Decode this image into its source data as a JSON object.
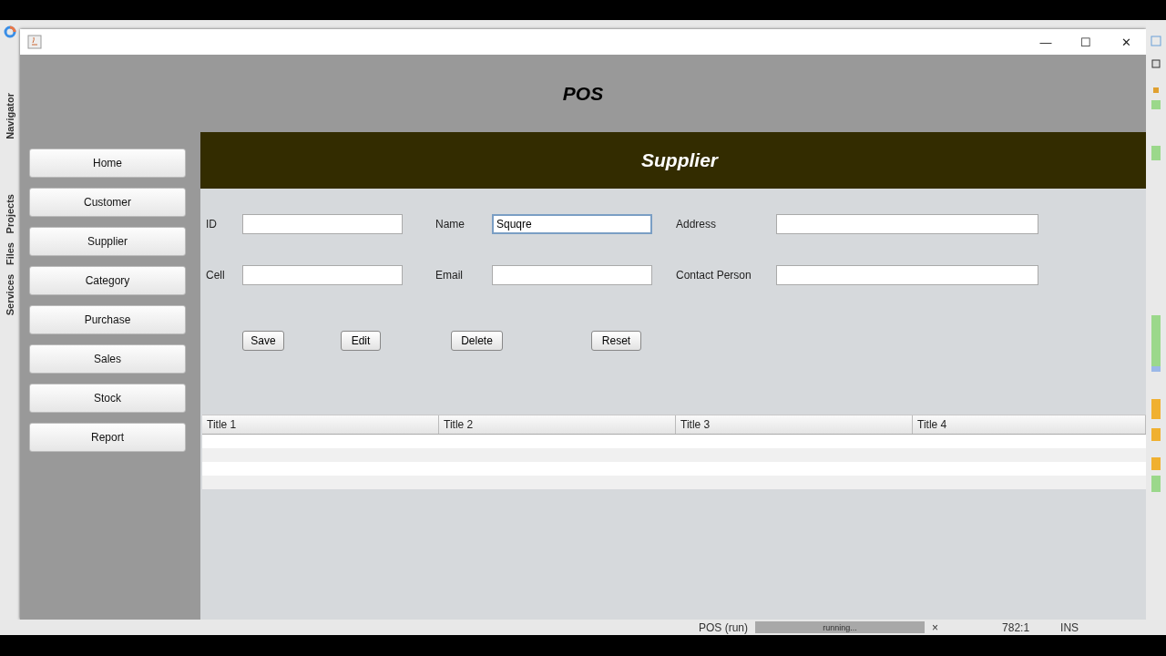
{
  "ide_side_tabs": [
    "Navigator",
    "Projects",
    "Files",
    "Services"
  ],
  "window": {
    "title_buttons": [
      "—",
      "☐",
      "✕"
    ]
  },
  "app_title": "POS",
  "sidebar": {
    "items": [
      {
        "label": "Home"
      },
      {
        "label": "Customer"
      },
      {
        "label": "Supplier"
      },
      {
        "label": "Category"
      },
      {
        "label": "Purchase"
      },
      {
        "label": "Sales"
      },
      {
        "label": "Stock"
      },
      {
        "label": "Report"
      }
    ]
  },
  "panel_title": "Supplier",
  "form": {
    "fields": [
      {
        "label": "ID",
        "focused": false
      },
      {
        "label": "Name",
        "value": "Squqre",
        "focused": true
      },
      {
        "label": "Address",
        "focused": false
      },
      {
        "label": "Cell",
        "focused": false
      },
      {
        "label": "Email",
        "focused": false
      },
      {
        "label": "Contact Person",
        "focused": false
      }
    ]
  },
  "buttons": [
    "Save",
    "Edit",
    "Delete",
    "Reset"
  ],
  "table": {
    "columns": [
      "Title 1",
      "Title 2",
      "Title 3",
      "Title 4"
    ]
  },
  "status_bar": {
    "project": "POS (run)",
    "progress": {
      "label": "running...",
      "level": 1
    },
    "close": "×",
    "position": "782:1",
    "mode": "INS"
  }
}
